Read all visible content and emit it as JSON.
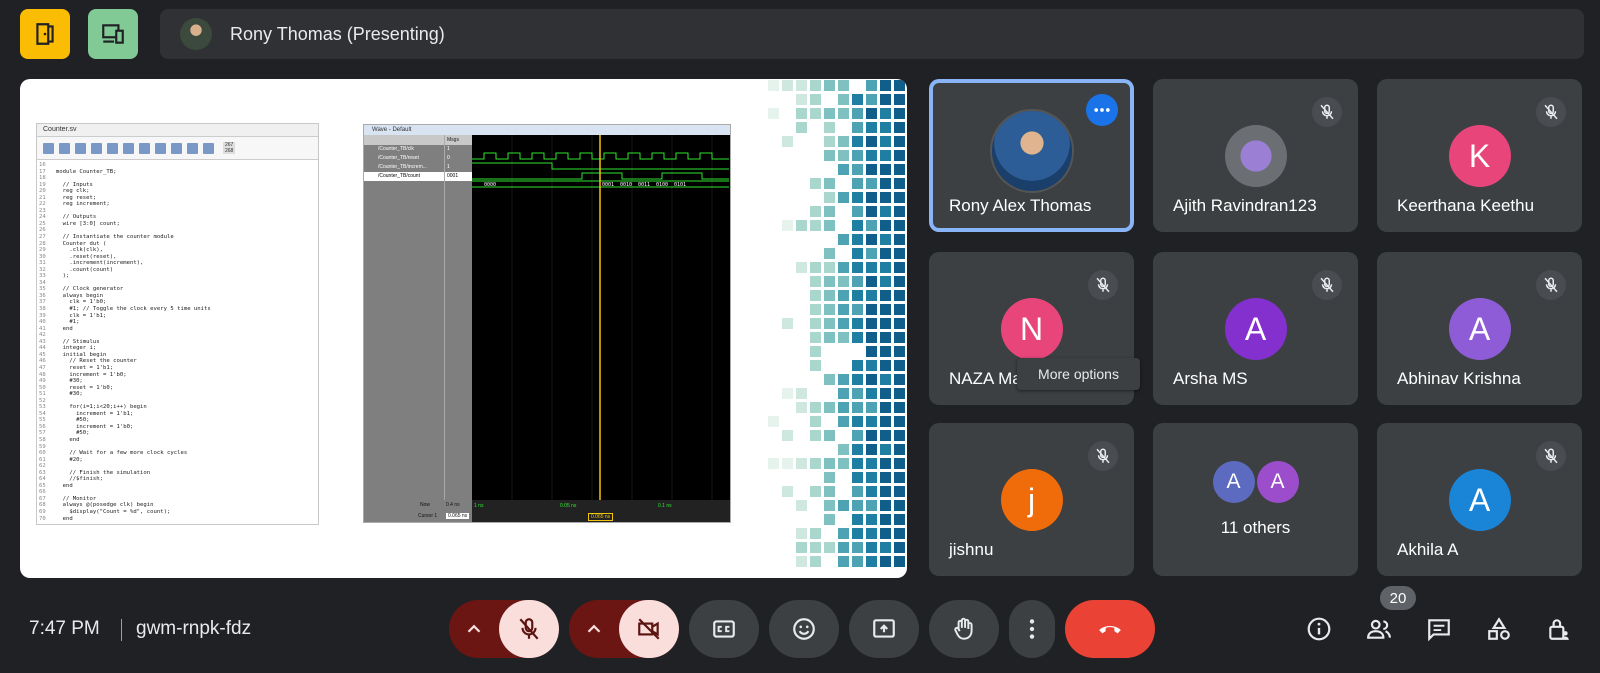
{
  "presenting": {
    "text": "Rony Thomas (Presenting)"
  },
  "colors": {
    "exit_btn": "#fbbc04",
    "companion_btn": "#81c995",
    "active_border": "#8ab4f8",
    "end_call": "#ea4335",
    "mute_bg": "#f9dedc"
  },
  "tiles": [
    {
      "name": "Rony Alex Thomas",
      "initial": "",
      "color": "#1e4d80",
      "muted": false,
      "active": true
    },
    {
      "name": "Ajith Ravindran123",
      "initial": "",
      "color": "#7c7f85",
      "muted": true,
      "active": false
    },
    {
      "name": "Keerthana Keethu",
      "initial": "K",
      "color": "#e8457b",
      "muted": true,
      "active": false
    },
    {
      "name": "NAZA Mar",
      "initial": "N",
      "color": "#e8457b",
      "muted": true,
      "active": false
    },
    {
      "name": "Arsha MS",
      "initial": "A",
      "color": "#8430ce",
      "muted": true,
      "active": false
    },
    {
      "name": "Abhinav Krishna",
      "initial": "A",
      "color": "#8e5cd6",
      "muted": true,
      "active": false
    },
    {
      "name": "jishnu",
      "initial": "j",
      "color": "#f06c0a",
      "muted": true,
      "active": false
    },
    {
      "name": "11 others",
      "initial": "A",
      "initial2": "A",
      "color": "#5c6bc0",
      "color2": "#9c4dcc",
      "muted": false,
      "active": false
    },
    {
      "name": "Akhila A",
      "initial": "A",
      "color": "#1a84d6",
      "muted": true,
      "active": false
    }
  ],
  "tooltip": "More options",
  "bottom": {
    "time": "7:47 PM",
    "meeting_code": "gwm-rnpk-fdz",
    "participant_count": "20"
  },
  "shared_screen": {
    "code_tab": "Counter.sv",
    "code_lines": [
      [
        "16",
        ""
      ],
      [
        "17",
        "module Counter_TB;"
      ],
      [
        "18",
        ""
      ],
      [
        "19",
        "  // Inputs"
      ],
      [
        "20",
        "  reg clk;"
      ],
      [
        "21",
        "  reg reset;"
      ],
      [
        "22",
        "  reg increment;"
      ],
      [
        "23",
        ""
      ],
      [
        "24",
        "  // Outputs"
      ],
      [
        "25",
        "  wire [3:0] count;"
      ],
      [
        "26",
        ""
      ],
      [
        "27",
        "  // Instantiate the counter module"
      ],
      [
        "28",
        "  Counter dut ("
      ],
      [
        "29",
        "    .clk(clk),"
      ],
      [
        "30",
        "    .reset(reset),"
      ],
      [
        "31",
        "    .increment(increment),"
      ],
      [
        "32",
        "    .count(count)"
      ],
      [
        "33",
        "  );"
      ],
      [
        "34",
        ""
      ],
      [
        "35",
        "  // Clock generator"
      ],
      [
        "36",
        "  always begin"
      ],
      [
        "37",
        "    clk = 1'b0;"
      ],
      [
        "38",
        "    #1; // Toggle the clock every 5 time units"
      ],
      [
        "39",
        "    clk = 1'b1;"
      ],
      [
        "40",
        "    #1;"
      ],
      [
        "41",
        "  end"
      ],
      [
        "42",
        ""
      ],
      [
        "43",
        "  // Stimulus"
      ],
      [
        "44",
        "  integer i;"
      ],
      [
        "45",
        "  initial begin"
      ],
      [
        "46",
        "    // Reset the counter"
      ],
      [
        "47",
        "    reset = 1'b1;"
      ],
      [
        "48",
        "    increment = 1'b0;"
      ],
      [
        "49",
        "    #30;"
      ],
      [
        "50",
        "    reset = 1'b0;"
      ],
      [
        "51",
        "    #30;"
      ],
      [
        "52",
        ""
      ],
      [
        "53",
        "    for(i=1;i<20;i++) begin"
      ],
      [
        "54",
        "      increment = 1'b1;"
      ],
      [
        "55",
        "      #50;"
      ],
      [
        "56",
        "      increment = 1'b0;"
      ],
      [
        "57",
        "      #50;"
      ],
      [
        "58",
        "    end"
      ],
      [
        "59",
        ""
      ],
      [
        "60",
        "    // Wait for a few more clock cycles"
      ],
      [
        "61",
        "    #20;"
      ],
      [
        "62",
        ""
      ],
      [
        "63",
        "    // Finish the simulation"
      ],
      [
        "64",
        "    //$finish;"
      ],
      [
        "65",
        "  end"
      ],
      [
        "66",
        ""
      ],
      [
        "67",
        "  // Monitor"
      ],
      [
        "68",
        "  always @(posedge clk) begin"
      ],
      [
        "69",
        "    $display(\"Count = %d\", count);"
      ],
      [
        "70",
        "  end"
      ]
    ],
    "wave_title": "Wave - Default",
    "wave_header": "Msgs",
    "wave_signals": [
      {
        "name": "/Counter_TB/clk",
        "value": "1"
      },
      {
        "name": "/Counter_TB/reset",
        "value": "0"
      },
      {
        "name": "/Counter_TB/increm...",
        "value": "1"
      },
      {
        "name": "/Counter_TB/count",
        "value": "0001"
      }
    ],
    "wave_now_label": "Now",
    "wave_now_value": "0.4 ns",
    "wave_cursor_label": "Cursor 1",
    "wave_cursor_value": "0.065 ns",
    "wave_count_values": [
      "0000",
      "0001",
      "0010",
      "0011",
      "0100",
      "0101"
    ],
    "wave_time_ticks": [
      "1 ns",
      "0.05 ns",
      "0.1 ns"
    ],
    "wave_cursor_marker": "0.065 ns",
    "code_counter": [
      "267",
      "268"
    ]
  }
}
